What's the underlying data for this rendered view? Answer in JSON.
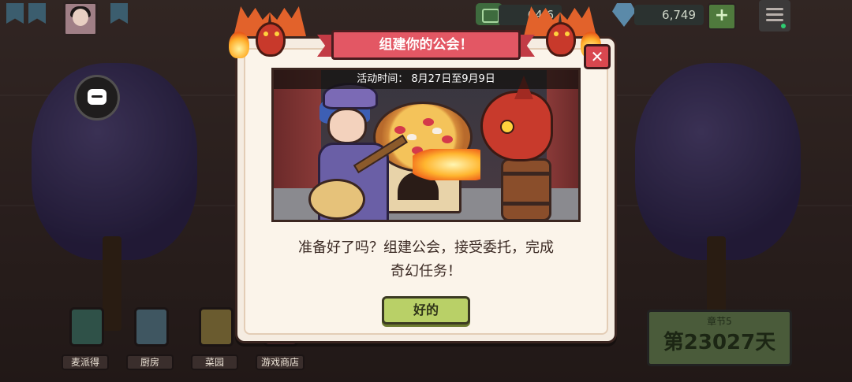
{
  "currency": {
    "cash": "64.6",
    "gems": "6,749",
    "add_label": "+"
  },
  "dialog": {
    "title": "组建你的公会！",
    "close_label": "✕",
    "event_time": "活动时间： 8月27日至9月9日",
    "message_line1": "准备好了吗？组建公会，接受委托，完成",
    "message_line2": "奇幻任务！",
    "ok_label": "好的"
  },
  "bottom_nav": [
    {
      "label": "麦派得",
      "icon": "tablet-icon"
    },
    {
      "label": "厨房",
      "icon": "kitchen-icon"
    },
    {
      "label": "菜园",
      "icon": "sprout-icon"
    },
    {
      "label": "游戏商店",
      "icon": "shop-icon"
    }
  ],
  "day_counter": {
    "chapter": "章节5",
    "days": "第23027天"
  },
  "colors": {
    "ribbon": "#e35764",
    "close": "#d9474f",
    "ok_button": "#b9d067",
    "dialog_bg": "#f5ece1"
  }
}
